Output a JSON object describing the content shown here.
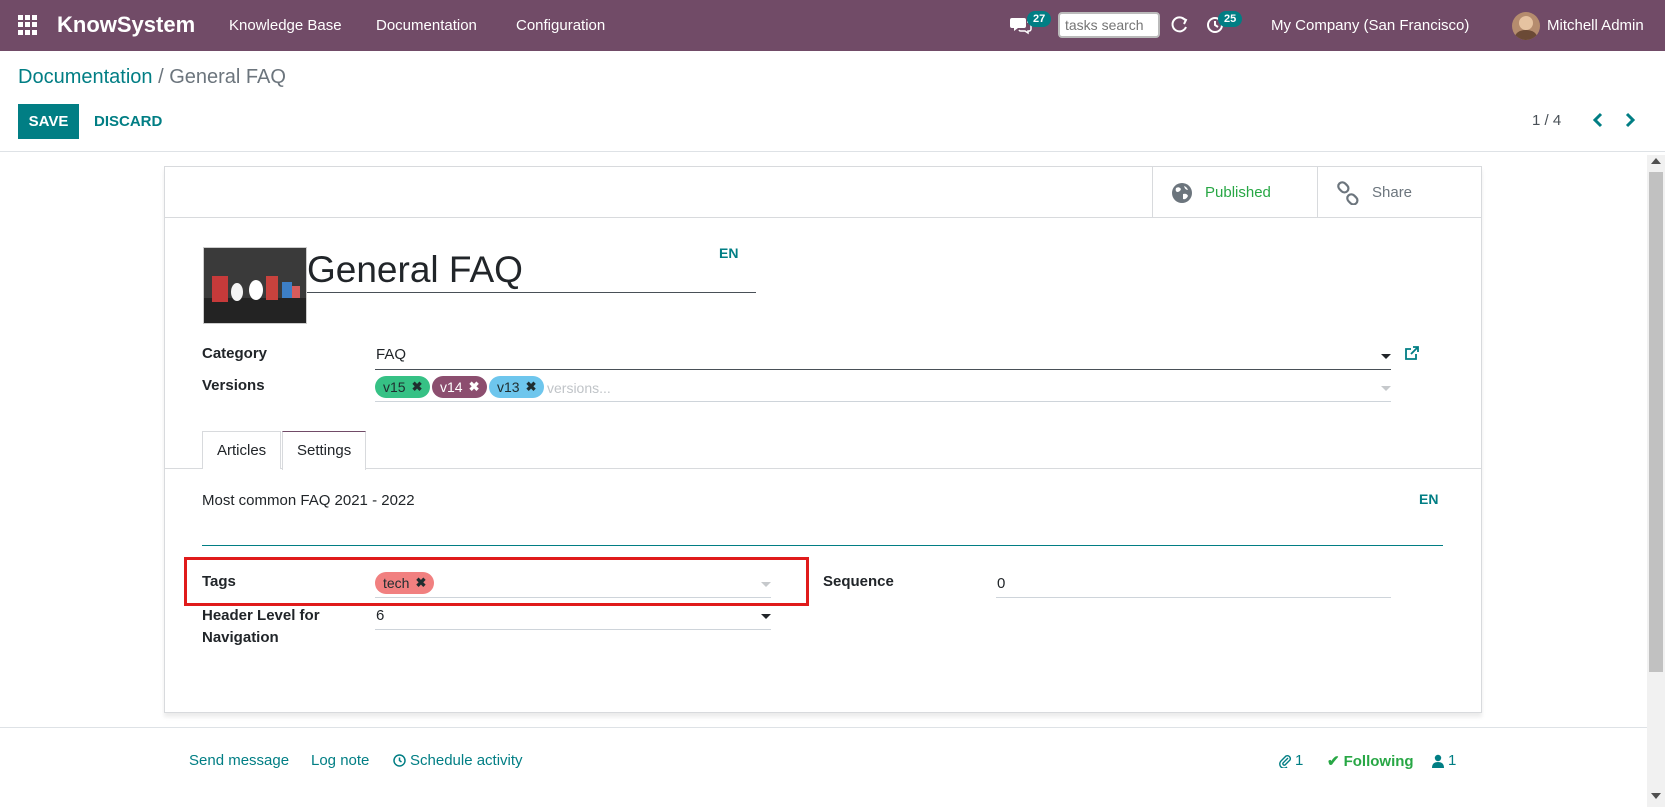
{
  "navbar": {
    "brand": "KnowSystem",
    "menu": [
      "Knowledge Base",
      "Documentation",
      "Configuration"
    ],
    "chat_badge": "27",
    "search_placeholder": "tasks search",
    "activity_badge": "25",
    "company": "My Company (San Francisco)",
    "user": "Mitchell Admin"
  },
  "control_panel": {
    "breadcrumb_parent": "Documentation",
    "breadcrumb_separator": "/",
    "breadcrumb_current": "General FAQ",
    "save_label": "SAVE",
    "discard_label": "DISCARD",
    "pager": "1 / 4"
  },
  "button_box": {
    "published_label": "Published",
    "share_label": "Share"
  },
  "form": {
    "title": "General FAQ",
    "title_lang": "EN",
    "category_label": "Category",
    "category_value": "FAQ",
    "versions_label": "Versions",
    "versions": [
      {
        "name": "v15",
        "color": "#36c185"
      },
      {
        "name": "v14",
        "color": "#8c4e6f"
      },
      {
        "name": "v13",
        "color": "#6ec6ed"
      }
    ],
    "versions_placeholder": "versions...",
    "tabs": [
      "Articles",
      "Settings"
    ],
    "active_tab": "Settings",
    "description": "Most common FAQ 2021 - 2022",
    "description_lang": "EN",
    "tags_label": "Tags",
    "tags": [
      {
        "name": "tech",
        "color": "#f18080"
      }
    ],
    "sequence_label": "Sequence",
    "sequence_value": "0",
    "header_level_label": "Header Level for Navigation",
    "header_level_value": "6"
  },
  "chatter": {
    "send_message": "Send message",
    "log_note": "Log note",
    "schedule_activity": "Schedule activity",
    "attachments_count": "1",
    "following_label": "Following",
    "followers_count": "1"
  },
  "colors": {
    "navbar": "#714B67",
    "primary": "#017e84",
    "published": "#28a745",
    "highlight": "#e01b1b"
  }
}
